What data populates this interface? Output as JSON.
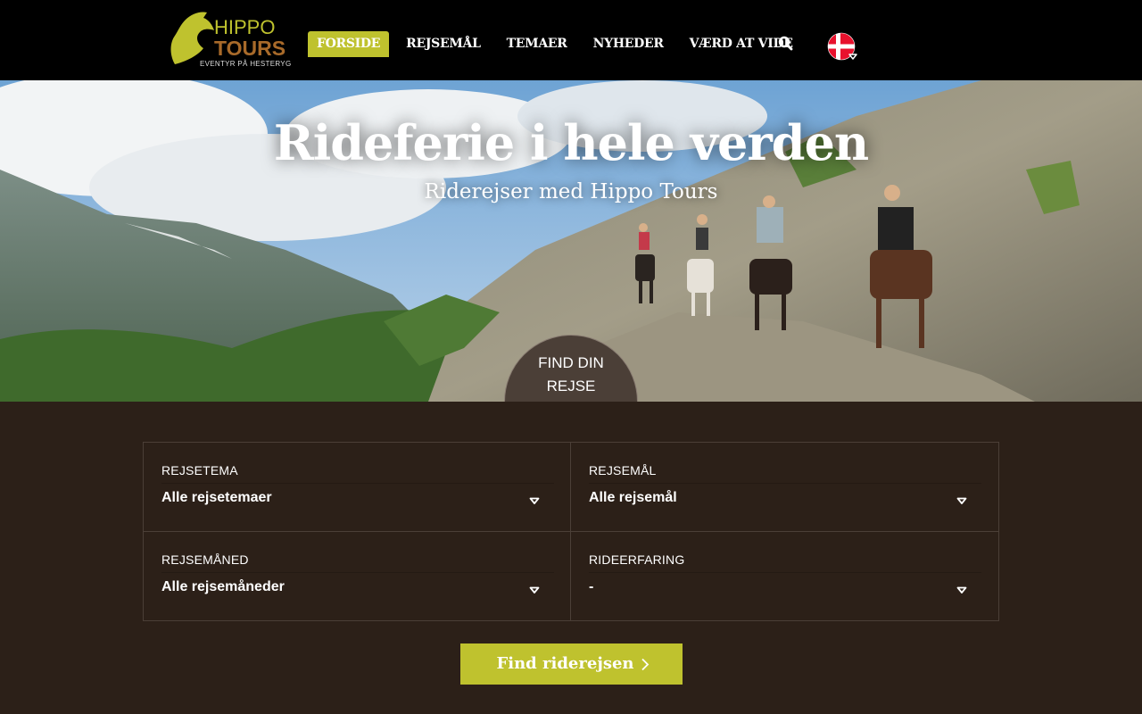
{
  "header": {
    "logo": {
      "line1": "HIPPO",
      "line2": "TOURS",
      "tagline": "EVENTYR PÅ HESTERYG"
    },
    "nav": [
      {
        "label": "FORSIDE",
        "active": true
      },
      {
        "label": "REJSEMÅL",
        "active": false
      },
      {
        "label": "TEMAER",
        "active": false
      },
      {
        "label": "NYHEDER",
        "active": false
      },
      {
        "label": "VÆRD AT VIDE",
        "active": false
      }
    ],
    "search_icon": "search-icon",
    "language_icon": "danish-flag-icon"
  },
  "hero": {
    "title": "Rideferie i hele verden",
    "subtitle": "Riderejser med Hippo Tours",
    "badge_line1": "FIND DIN",
    "badge_line2": "REJSE"
  },
  "search_form": {
    "fields": [
      {
        "label": "REJSETEMA",
        "value": "Alle rejsetemaer"
      },
      {
        "label": "REJSEMÅL",
        "value": "Alle rejsemål"
      },
      {
        "label": "REJSEMÅNED",
        "value": "Alle rejsemåneder"
      },
      {
        "label": "RIDEERFARING",
        "value": "-"
      }
    ],
    "submit_label": "Find riderejsen"
  },
  "colors": {
    "accent": "#bfc22e",
    "header_bg": "#000000",
    "page_bg": "#2c2018",
    "badge_bg": "#4b3f37"
  }
}
